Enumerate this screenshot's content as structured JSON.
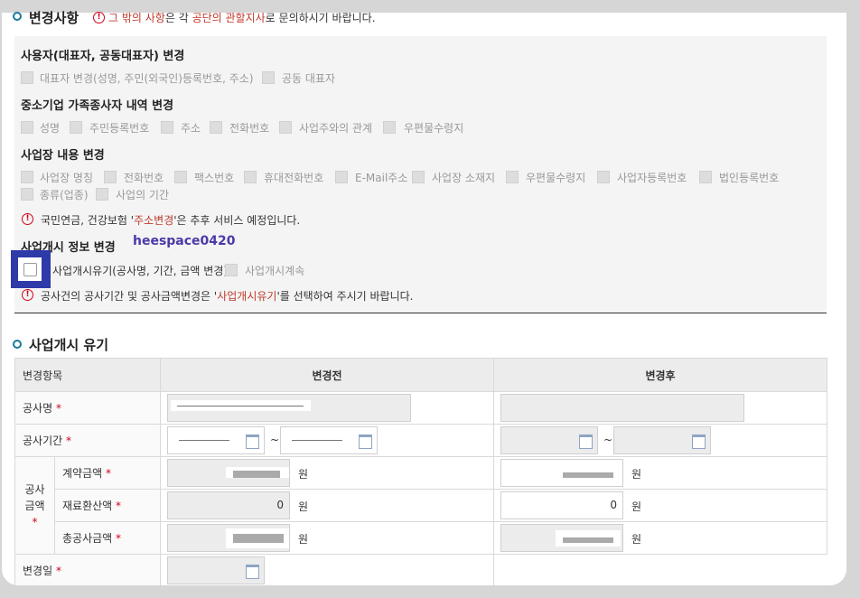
{
  "change_section": {
    "title": "변경사항",
    "notice_prefix": "그 밖의 사항",
    "notice_mid1": "은 각 ",
    "notice_red2": "공단의 관할지사",
    "notice_suffix": "로 문의하시기 바랍니다.",
    "groups": {
      "representative": {
        "title": "사용자(대표자, 공동대표자) 변경",
        "options": [
          "대표자 변경(성명, 주민(외국인)등록번호, 주소)",
          "공동 대표자"
        ]
      },
      "family": {
        "title": "중소기업 가족종사자 내역 변경",
        "options": [
          "성명",
          "주민등록번호",
          "주소",
          "전화번호",
          "사업주와의 관계",
          "우편물수령지"
        ]
      },
      "workplace": {
        "title": "사업장 내용 변경",
        "options_row1": [
          "사업장 명칭",
          "전화번호",
          "팩스번호",
          "휴대전화번호",
          "E-Mail주소",
          "사업장 소재지",
          "우편물수령지",
          "사업자등록번호",
          "법인등록번호"
        ],
        "options_row2": [
          "종류(업종)",
          "사업의 기간"
        ],
        "notice_prefix": "국민연금, 건강보험 '",
        "notice_red": "주소변경",
        "notice_suffix": "'은 추후 서비스 예정입니다."
      },
      "start_info": {
        "title": "사업개시 정보 변경",
        "watermark": "heespace0420",
        "options": [
          "사업개시유기(공사명, 기간, 금액 변경)",
          "사업개시계속"
        ],
        "notice_prefix": "공사건의 공사기간 및 공사금액변경은 '",
        "notice_red": "사업개시유기",
        "notice_suffix": "'를 선택하여 주시기 바랍니다."
      }
    }
  },
  "defer_section": {
    "title": "사업개시 유기",
    "headers": [
      "변경항목",
      "변경전",
      "변경후"
    ],
    "rows": {
      "project_name": "공사명",
      "project_period": "공사기간",
      "amount_group": "공사금액",
      "contract_amount": "계약금액",
      "material_amount": "재료환산액",
      "total_amount": "총공사금액",
      "change_date": "변경일"
    },
    "required_mark": "*",
    "tilde": "~",
    "won": "원",
    "material_before": "0",
    "material_after": "0"
  }
}
